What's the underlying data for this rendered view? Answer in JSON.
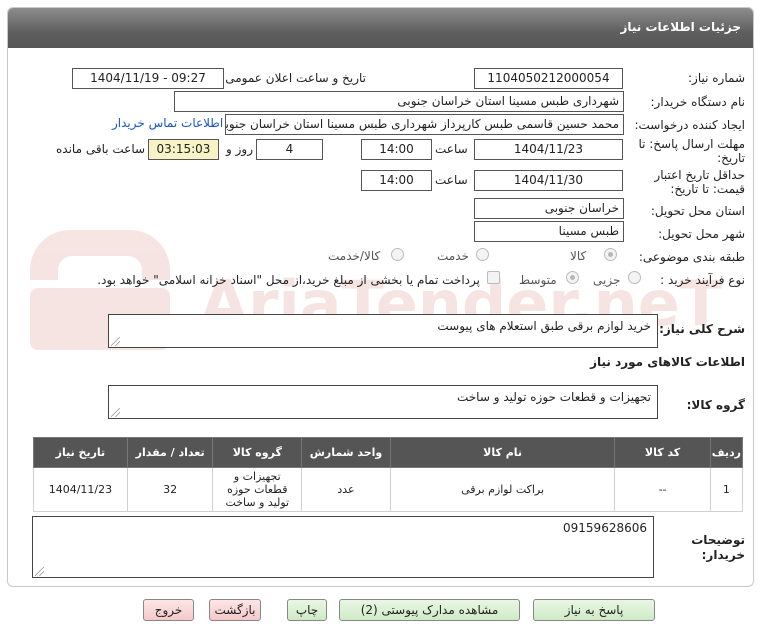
{
  "panel": {
    "title": "جزئیات اطلاعات نیاز"
  },
  "fields": {
    "need_number": {
      "label": "شماره نیاز:",
      "value": "1104050212000054"
    },
    "announce_datetime": {
      "label": "تاریخ و ساعت اعلان عمومی:",
      "value": "1404/11/19 - 09:27"
    },
    "buyer_org": {
      "label": "نام دستگاه خریدار:",
      "value": "شهرداری طبس مسینا استان خراسان جنوبی"
    },
    "requester": {
      "label": "ایجاد کننده درخواست:",
      "value": "محمد حسین قاسمی طبس کارپرداز شهرداری طبس مسینا استان خراسان جنوبی",
      "contact_link": "اطلاعات تماس خریدار"
    },
    "deadline": {
      "label_line1": "مهلت ارسال پاسخ: تا",
      "label_line2": "تاریخ:",
      "date": "1404/11/23",
      "time_label": "ساعت",
      "time": "14:00",
      "days": "4",
      "days_label": "روز و",
      "remaining": "03:15:03",
      "remaining_label": "ساعت باقی مانده"
    },
    "price_validity": {
      "label_line1": "حداقل تاریخ اعتبار",
      "label_line2": "قیمت: تا تاریخ:",
      "date": "1404/11/30",
      "time_label": "ساعت",
      "time": "14:00"
    },
    "delivery_province": {
      "label": "استان محل تحویل:",
      "value": "خراسان جنوبی"
    },
    "delivery_city": {
      "label": "شهر محل تحویل:",
      "value": "طبس مسینا"
    },
    "category": {
      "label": "طبقه بندی موضوعی:",
      "options": [
        "کالا",
        "خدمت",
        "کالا/خدمت"
      ],
      "selected": "کالا"
    },
    "purchase_type": {
      "label": "نوع فرآیند خرید :",
      "options": [
        "جزیی",
        "متوسط"
      ],
      "selected": "متوسط",
      "note": "پرداخت تمام یا بخشی از مبلغ خرید،از محل \"اسناد خزانه اسلامی\" خواهد بود."
    }
  },
  "summary": {
    "label": "شرح کلی نیاز:",
    "value": "خرید لوازم برقی طبق استعلام های پیوست"
  },
  "goods_section": {
    "title": "اطلاعات کالاهای مورد نیاز"
  },
  "goods_group": {
    "label": "گروه کالا:",
    "value": "تجهیزات و قطعات حوزه تولید و ساخت"
  },
  "table": {
    "headers": [
      "ردیف",
      "کد کالا",
      "نام کالا",
      "واحد شمارش",
      "گروه کالا",
      "تعداد / مقدار",
      "تاریخ نیاز"
    ],
    "rows": [
      [
        "1",
        "--",
        "براکت لوازم برقی",
        "عدد",
        "تجهیزات و قطعات حوزه تولید و ساخت",
        "32",
        "1404/11/23"
      ]
    ]
  },
  "buyer_notes": {
    "label_line1": "توضیحات",
    "label_line2": "خریدار:",
    "value": "09159628606"
  },
  "buttons": {
    "reply": "پاسخ به نیاز",
    "view_docs": "مشاهده مدارک پیوستی (2)",
    "print": "چاپ",
    "back": "بازگشت",
    "exit": "خروج"
  },
  "watermark": {
    "text": "AriaTender.neT"
  },
  "colors": {
    "header": "#5f5f5f",
    "table_header": "#555555",
    "link": "#1a55c8",
    "remaining_bg": "#f7f3c7",
    "button_green": "#cfeac6",
    "button_pink": "#f4c9c9"
  }
}
